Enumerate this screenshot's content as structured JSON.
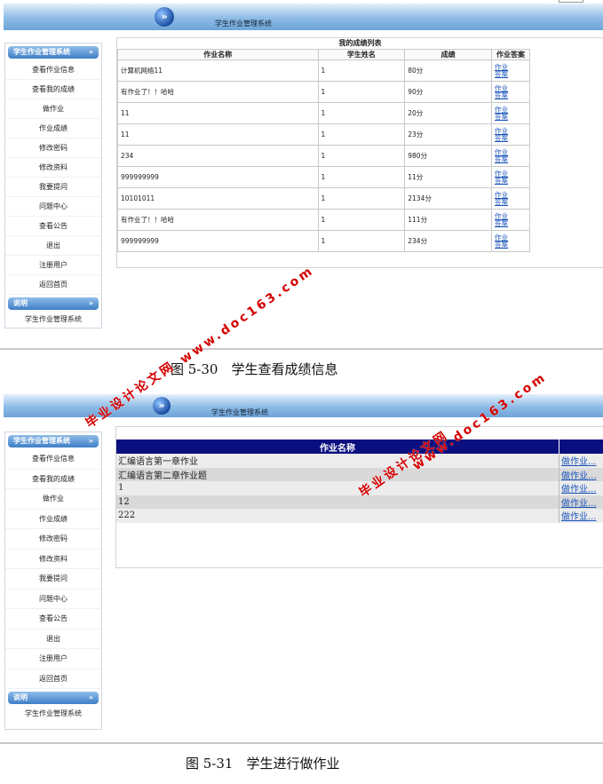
{
  "app_title": "学生作业管理系统",
  "logo_glyph": "»",
  "sidebar": {
    "header": "学生作业管理系统",
    "items": [
      "查看作业信息",
      "查看我的成绩",
      "做作业",
      "作业成绩",
      "修改密码",
      "修改资料",
      "我要提问",
      "问题中心",
      "查看公告",
      "退出",
      "注册用户",
      "返回首页"
    ],
    "note_header": "说明",
    "note_text": "学生作业管理系统",
    "chevron": "»"
  },
  "grades": {
    "title": "我的成绩列表",
    "columns": [
      "作业名称",
      "学生姓名",
      "成绩",
      "作业答案"
    ],
    "rows": [
      {
        "name": "计算机网络11",
        "student": "1",
        "score": "80分",
        "answer": "作业答案"
      },
      {
        "name": "有作业了！！哈哈",
        "student": "1",
        "score": "90分",
        "answer": "作业答案"
      },
      {
        "name": "11",
        "student": "1",
        "score": "20分",
        "answer": "作业答案"
      },
      {
        "name": "11",
        "student": "1",
        "score": "23分",
        "answer": "作业答案"
      },
      {
        "name": "234",
        "student": "1",
        "score": "980分",
        "answer": "作业答案"
      },
      {
        "name": "999999999",
        "student": "1",
        "score": "11分",
        "answer": "作业答案"
      },
      {
        "name": "10101011",
        "student": "1",
        "score": "2134分",
        "answer": "作业答案"
      },
      {
        "name": "有作业了！！哈哈",
        "student": "1",
        "score": "111分",
        "answer": "作业答案"
      },
      {
        "name": "999999999",
        "student": "1",
        "score": "234分",
        "answer": "作业答案"
      }
    ]
  },
  "homework": {
    "column": "作业名称",
    "rows": [
      {
        "name": "汇编语言第一章作业",
        "action": "做作业..."
      },
      {
        "name": "汇编语言第二章作业题",
        "action": "做作业..."
      },
      {
        "name": "1",
        "action": "做作业..."
      },
      {
        "name": "12",
        "action": "做作业..."
      },
      {
        "name": "222",
        "action": "做作业..."
      }
    ]
  },
  "captions": {
    "fig1": "图 5-30　学生查看成绩信息",
    "fig2": "图 5-31　学生进行做作业"
  },
  "watermarks": {
    "site": "www.doc163.com",
    "label": "毕业设计论文网"
  },
  "colors": {
    "banner": "#6ea4d8",
    "table_header": "#0a0f80",
    "link": "#1a55b8",
    "watermark": "#d40000"
  }
}
